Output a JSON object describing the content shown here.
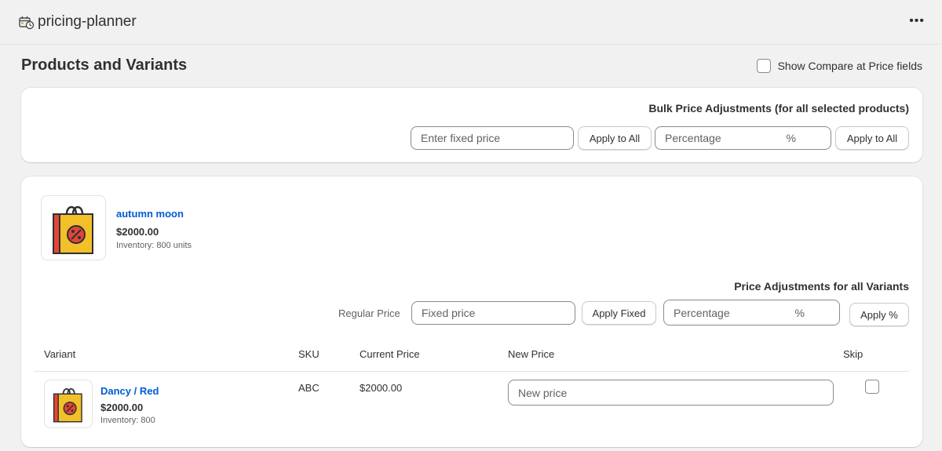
{
  "app": {
    "title": "pricing-planner",
    "icon": "calendar-clock-icon",
    "more": "•••"
  },
  "page": {
    "title": "Products and Variants",
    "compare_label": "Show Compare at Price fields",
    "compare_checked": false
  },
  "bulk": {
    "heading": "Bulk Price Adjustments (for all selected products)",
    "fixed_placeholder": "Enter fixed price",
    "apply_fixed": "Apply to All",
    "percent_placeholder": "Percentage",
    "percent_suffix": "%",
    "apply_percent": "Apply to All"
  },
  "product": {
    "name": "autumn moon",
    "price": "$2000.00",
    "inventory": "Inventory: 800 units",
    "icon": "shopping-bag-percent-icon",
    "variant_adjust": {
      "heading": "Price Adjustments for all Variants",
      "regular_label": "Regular Price",
      "fixed_placeholder": "Fixed price",
      "apply_fixed": "Apply Fixed",
      "percent_placeholder": "Percentage",
      "percent_suffix": "%",
      "apply_percent": "Apply %"
    },
    "table": {
      "headers": {
        "variant": "Variant",
        "sku": "SKU",
        "current": "Current Price",
        "new": "New Price",
        "skip": "Skip"
      },
      "rows": [
        {
          "name": "Dancy / Red",
          "price": "$2000.00",
          "inventory": "Inventory: 800",
          "sku": "ABC",
          "current_price": "$2000.00",
          "new_price_placeholder": "New price",
          "skip": false
        }
      ]
    }
  },
  "colors": {
    "link": "#005bd3",
    "bag_orange": "#f2c028",
    "bag_red": "#e2453a"
  }
}
